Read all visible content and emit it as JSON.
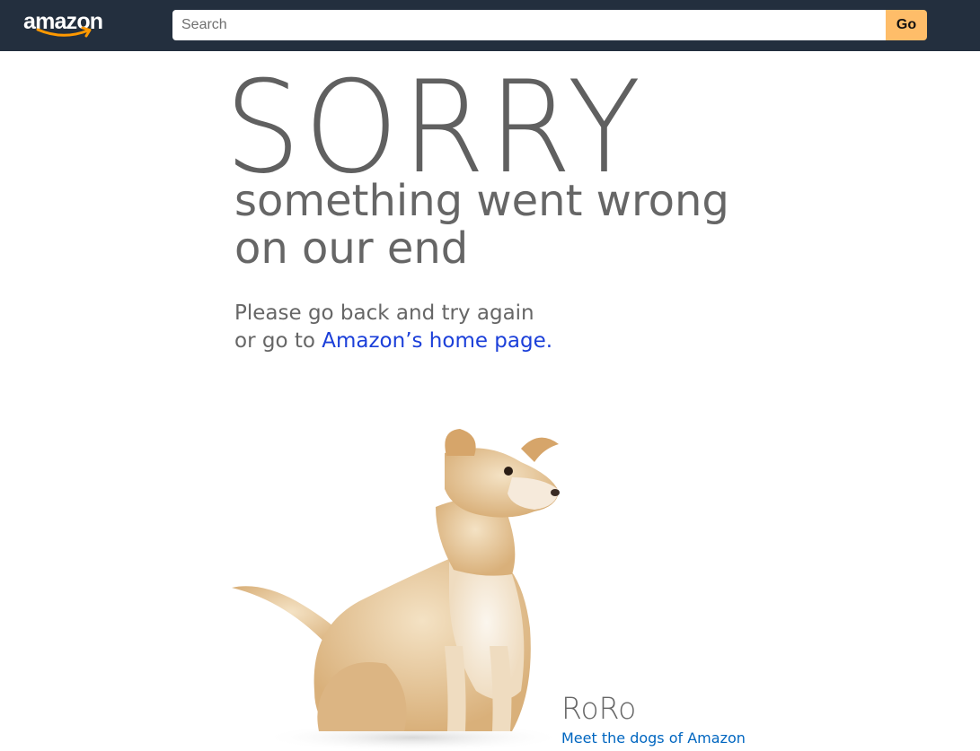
{
  "header": {
    "logo_text": "amazon",
    "search": {
      "placeholder": "Search",
      "value": ""
    },
    "go_label": "Go",
    "colors": {
      "bar": "#232f3e",
      "button": "#febd69",
      "smile": "#ff9900"
    }
  },
  "error": {
    "title": "SORRY",
    "subtitle_line1": "something went wrong",
    "subtitle_line2": "on our end",
    "message_line1": "Please go back and try again",
    "message_line2_prefix": "or go to",
    "home_link": "Amazon’s home page."
  },
  "dog": {
    "image": "dog-photo",
    "name": "RoRo",
    "link": "Meet the dogs of Amazon"
  }
}
